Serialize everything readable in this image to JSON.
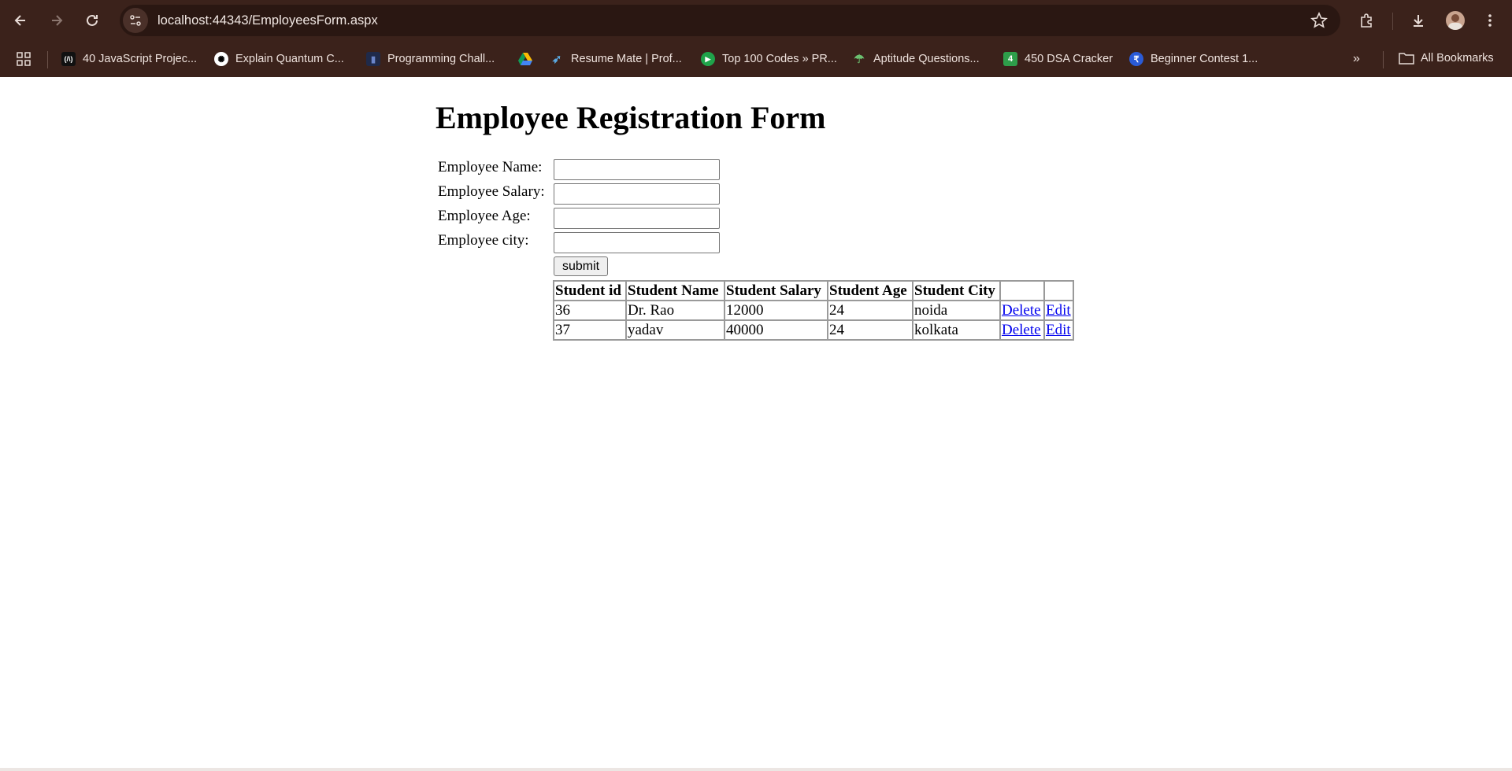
{
  "browser": {
    "url": "localhost:44343/EmployeesForm.aspx",
    "bookmarks": [
      {
        "label": "40 JavaScript Projec...",
        "icon": "code-logo-icon"
      },
      {
        "label": "Explain Quantum C...",
        "icon": "openai-icon"
      },
      {
        "label": "Programming Chall...",
        "icon": "code-icon"
      },
      {
        "label": "",
        "icon": "google-drive-icon"
      },
      {
        "label": "Resume Mate | Prof...",
        "icon": "bird-icon"
      },
      {
        "label": "Top 100 Codes » PR...",
        "icon": "play-icon"
      },
      {
        "label": "Aptitude Questions...",
        "icon": "mushroom-icon"
      },
      {
        "label": "450 DSA Cracker",
        "icon": "number-4-icon"
      },
      {
        "label": "Beginner Contest 1...",
        "icon": "contest-icon"
      }
    ],
    "all_bookmarks_label": "All Bookmarks"
  },
  "form": {
    "title": "Employee Registration Form",
    "fields": [
      {
        "label": "Employee Name:",
        "value": ""
      },
      {
        "label": "Employee Salary:",
        "value": ""
      },
      {
        "label": "Employee Age:",
        "value": ""
      },
      {
        "label": "Employee city:",
        "value": ""
      }
    ],
    "submit_label": "submit"
  },
  "table": {
    "headers": [
      "Student id",
      "Student Name",
      "Student Salary",
      "Student Age",
      "Student City",
      "",
      ""
    ],
    "rows": [
      {
        "id": "36",
        "name": "Dr. Rao",
        "salary": "12000",
        "age": "24",
        "city": "noida",
        "delete": "Delete",
        "edit": "Edit"
      },
      {
        "id": "37",
        "name": "yadav",
        "salary": "40000",
        "age": "24",
        "city": "kolkata",
        "delete": "Delete",
        "edit": "Edit"
      }
    ]
  },
  "colors": {
    "chrome": "#3b221b",
    "omnibox": "#2a1712",
    "link": "#0000ee"
  }
}
